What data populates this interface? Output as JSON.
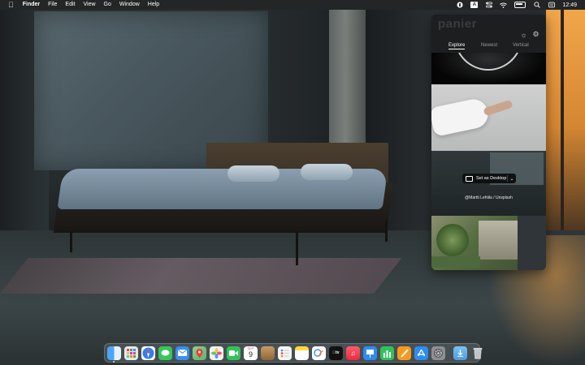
{
  "menubar": {
    "app_name": "Finder",
    "menus": [
      "File",
      "Edit",
      "View",
      "Go",
      "Window",
      "Help"
    ],
    "input_badge": "A",
    "clock": "12:49"
  },
  "panel": {
    "logo": "panier",
    "tabs": [
      {
        "label": "Explore",
        "active": true
      },
      {
        "label": "Newest",
        "active": false
      },
      {
        "label": "Vertical",
        "active": false
      }
    ],
    "set_desktop_label": "Set as Desktop",
    "photo_credit": "@Martti Lehtila / Unsplash"
  },
  "dock": {
    "apps": [
      {
        "name": "finder-icon",
        "color": "#2f8df0"
      },
      {
        "name": "launchpad-icon",
        "color": "#e7e7ea"
      },
      {
        "name": "safari-icon",
        "color": "#2f7ff0"
      },
      {
        "name": "messages-icon",
        "color": "#35c659"
      },
      {
        "name": "mail-icon",
        "color": "#3b8cf0"
      },
      {
        "name": "maps-icon",
        "color": "#5bb36a"
      },
      {
        "name": "photos-icon",
        "color": "#f3f3f3"
      },
      {
        "name": "facetime-icon",
        "color": "#32c356"
      },
      {
        "name": "calendar-icon",
        "color": "#ffffff"
      },
      {
        "name": "notes-brown-icon",
        "color": "#a57b4a"
      },
      {
        "name": "reminders-icon",
        "color": "#f5f5f5"
      },
      {
        "name": "notes-icon",
        "color": "#ffd93b"
      },
      {
        "name": "freeform-icon",
        "color": "#ffffff"
      },
      {
        "name": "apple-tv-icon",
        "color": "#111111"
      },
      {
        "name": "music-icon",
        "color": "#fa3c4f"
      },
      {
        "name": "keynote-icon",
        "color": "#2e8cf0"
      },
      {
        "name": "numbers-icon",
        "color": "#33c25a"
      },
      {
        "name": "pages-icon",
        "color": "#f59a1e"
      },
      {
        "name": "app-store-icon",
        "color": "#2e8cf0"
      },
      {
        "name": "system-settings-icon",
        "color": "#8e8e93"
      },
      {
        "name": "downloads-folder-icon",
        "color": "#5aa7e6"
      },
      {
        "name": "trash-icon",
        "color": "#c9ccd0"
      }
    ],
    "calendar_month": "SEP",
    "calendar_day": "9"
  }
}
